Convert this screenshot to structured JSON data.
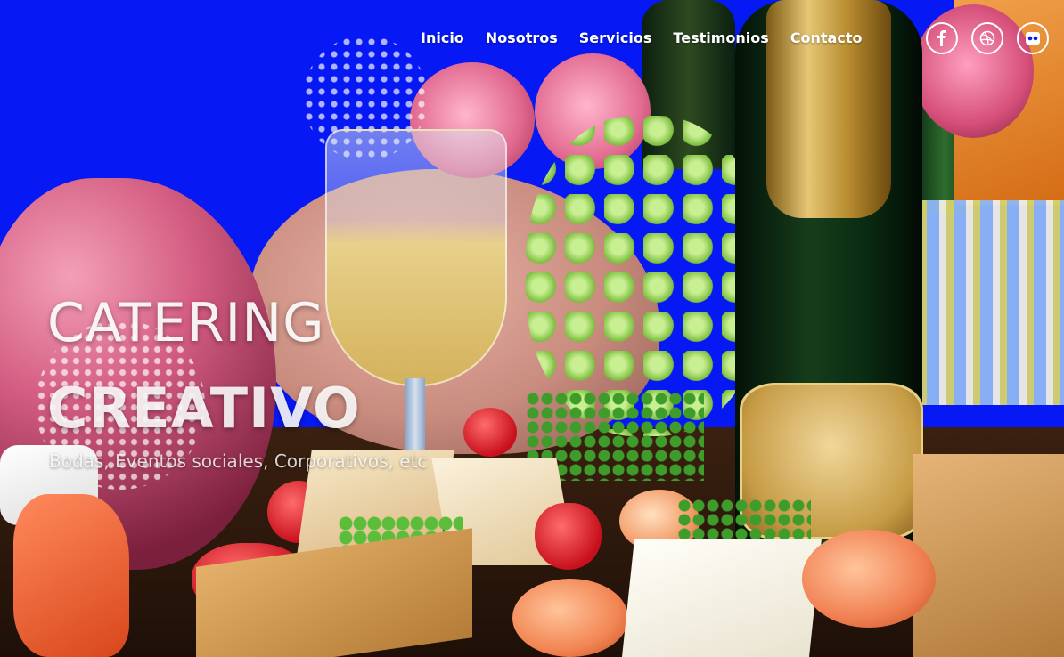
{
  "nav": {
    "items": [
      {
        "label": "Inicio"
      },
      {
        "label": "Nosotros"
      },
      {
        "label": "Servicios"
      },
      {
        "label": "Testimonios"
      },
      {
        "label": "Contacto"
      }
    ]
  },
  "social": [
    {
      "icon": "facebook-icon"
    },
    {
      "icon": "dribbble-icon"
    },
    {
      "icon": "flickr-icon"
    }
  ],
  "hero": {
    "title_line1": "CATERING",
    "title_line2": "CREATIVO",
    "subtitle": "Bodas, Eventos sociales, Corporativos, etc"
  },
  "colors": {
    "background_blue": "#0618f4",
    "text": "#ffffff"
  }
}
